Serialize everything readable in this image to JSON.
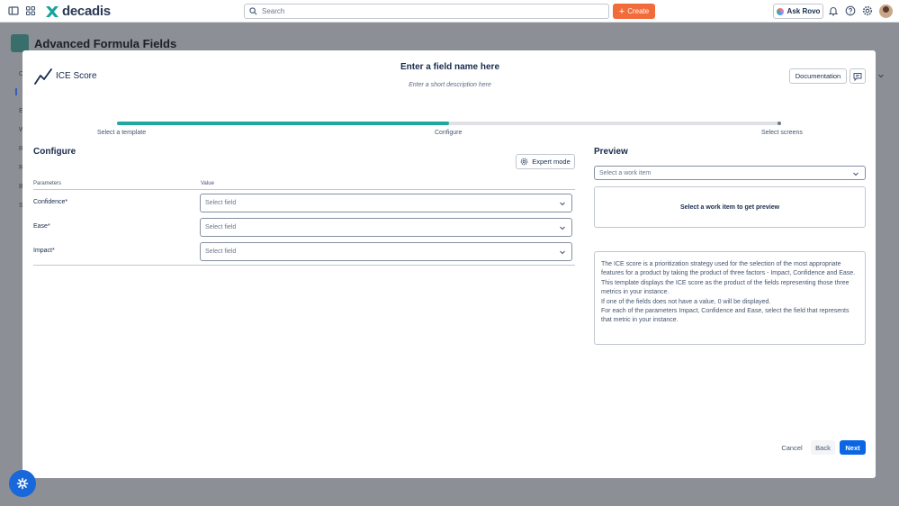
{
  "topbar": {
    "app_name": "decadis",
    "search_placeholder": "Search",
    "create_label": "Create",
    "ask_rovo_label": "Ask Rovo"
  },
  "background": {
    "page_title": "Advanced Formula Fields",
    "sidebar_letters": [
      "C",
      "E",
      "W",
      "R",
      "R",
      "B",
      "S"
    ]
  },
  "modal": {
    "template_name": "ICE Score",
    "field_name_placeholder": "Enter a field name here",
    "field_description_placeholder": "Enter a short description here",
    "documentation_label": "Documentation",
    "steps": [
      "Select a template",
      "Configure",
      "Select screens"
    ],
    "progress_fraction": 0.5,
    "configure": {
      "title": "Configure",
      "expert_mode_label": "Expert mode",
      "col_parameters": "Parameters",
      "col_value": "Value",
      "rows": [
        {
          "label": "Confidence*",
          "value": "Select field"
        },
        {
          "label": "Ease*",
          "value": "Select field"
        },
        {
          "label": "Impact*",
          "value": "Select field"
        }
      ]
    },
    "preview": {
      "title": "Preview",
      "work_item_placeholder": "Select a work item",
      "empty_message": "Select a work item to get preview",
      "description_lines": [
        "The ICE score is a prioritization strategy used for the selection of the most appropriate features for a product by taking the product of three factors - Impact, Confidence and Ease.",
        "This template displays the ICE score as the product of the fields representing those three metrics in your instance.",
        "If one of the fields does not have a value, 0 will be displayed.",
        "For each of the parameters Impact, Confidence and Ease, select the field that represents that metric in your instance."
      ]
    },
    "footer": {
      "cancel_label": "Cancel",
      "back_label": "Back",
      "next_label": "Next"
    }
  },
  "colors": {
    "accent_teal": "#1fa89d",
    "primary_blue": "#0c66e4",
    "create_orange": "#f26b3a"
  }
}
